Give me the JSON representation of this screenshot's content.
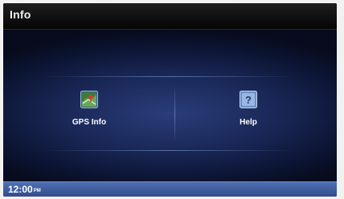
{
  "header": {
    "title": "Info"
  },
  "menu": {
    "items": [
      {
        "label": "GPS Info",
        "icon": "gps-info-icon"
      },
      {
        "label": "Help",
        "icon": "help-icon"
      }
    ]
  },
  "status": {
    "time": "12:00",
    "ampm": "PM"
  },
  "colors": {
    "background_center": "#2a3d7a",
    "background_edge": "#070b1d",
    "status_bar": "#3f5ea0",
    "title_bar": "#0f0f0f"
  }
}
